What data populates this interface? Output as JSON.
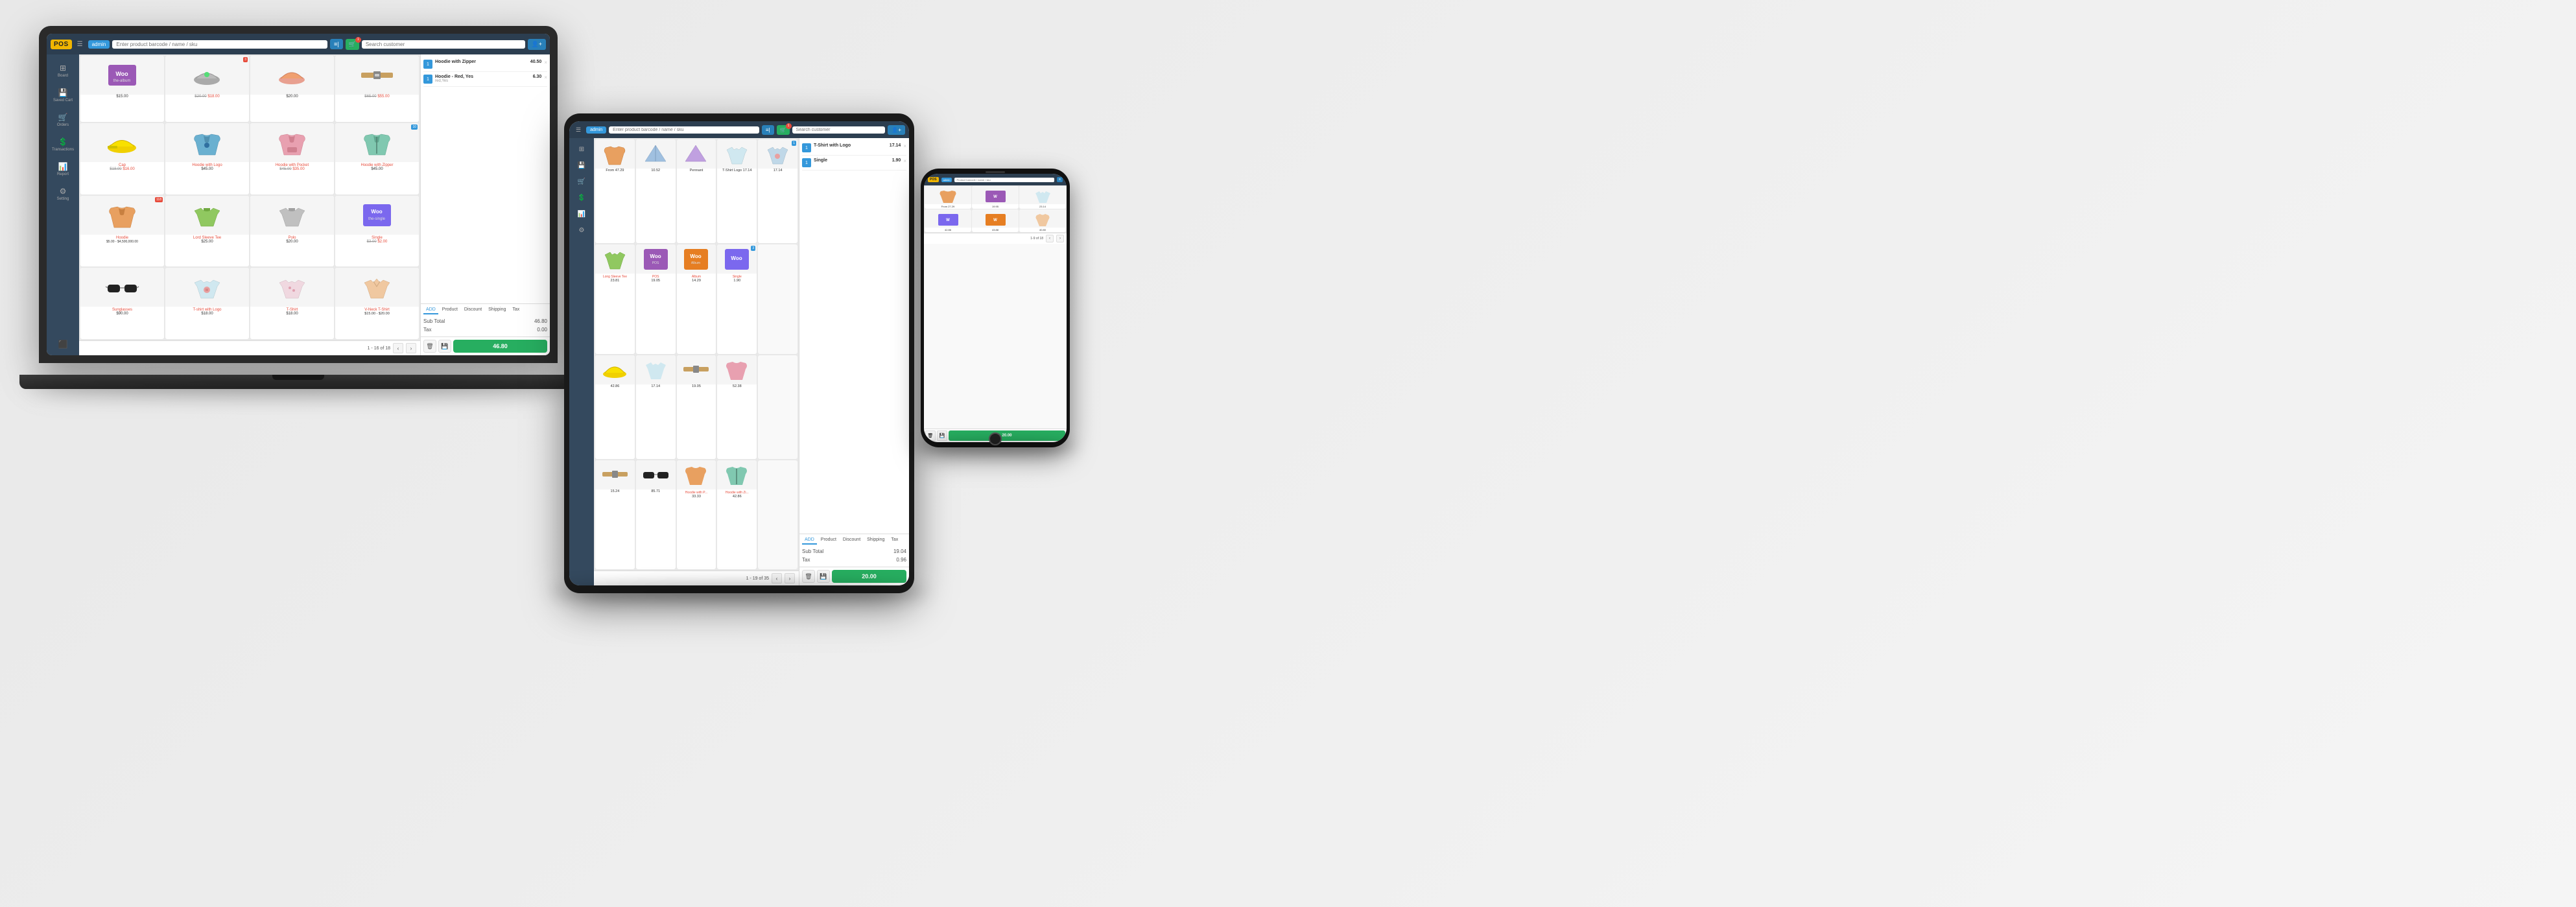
{
  "laptop": {
    "header": {
      "logo": "POS",
      "menu_icon": "☰",
      "admin_label": "admin",
      "search_product_placeholder": "Enter product barcode / name / sku",
      "filter_icon": "⚡",
      "cart_count": "1",
      "search_customer_placeholder": "Search customer",
      "add_customer_icon": "+"
    },
    "sidebar": {
      "items": [
        {
          "label": "Board",
          "icon": "⊞"
        },
        {
          "label": "Saved Cart",
          "icon": "💾"
        },
        {
          "label": "Orders",
          "icon": "🛒"
        },
        {
          "label": "Transactions",
          "icon": "$"
        },
        {
          "label": "Report",
          "icon": "©"
        },
        {
          "label": "Setting",
          "icon": "⚙"
        }
      ],
      "bottom_icon": "⬛"
    },
    "products": [
      {
        "name": "WooLogo",
        "price": "$15.00",
        "img_type": "woo",
        "badge": ""
      },
      {
        "name": "",
        "price": "$20.00 $18.00",
        "img_type": "hat_grey",
        "badge": "3"
      },
      {
        "name": "",
        "price": "$20.00",
        "img_type": "hat_orange",
        "badge": ""
      },
      {
        "name": "",
        "price": "$65.00 $55.00",
        "img_type": "belt",
        "badge": ""
      },
      {
        "name": "Cap",
        "price": "$18.00 $16.00",
        "img_type": "cap_yellow",
        "badge": ""
      },
      {
        "name": "Hoodie with Logo",
        "price": "$45.00",
        "img_type": "hoodie_blue",
        "badge": ""
      },
      {
        "name": "Hoodie with Pocket",
        "price": "$45.00 $35.00",
        "img_type": "hoodie_pink",
        "badge": ""
      },
      {
        "name": "Hoodie with Zipper",
        "price": "$45.00",
        "img_type": "hoodie_teal",
        "badge": "10"
      },
      {
        "name": "Hoodie",
        "price": "$5.00 - $4,500,000.00",
        "img_type": "hoodie_orange",
        "badge": "118"
      },
      {
        "name": "Lord Sleeve Tee",
        "price": "$25.00",
        "img_type": "tshirt_green",
        "badge": ""
      },
      {
        "name": "Polo",
        "price": "$20.00",
        "img_type": "polo_grey",
        "badge": ""
      },
      {
        "name": "Single",
        "price": "$3.00 $2.00",
        "img_type": "woo_single",
        "badge": ""
      },
      {
        "name": "Sunglasses",
        "price": "$90.00",
        "img_type": "glasses",
        "badge": ""
      },
      {
        "name": "T-shirt with Logo",
        "price": "$18.00",
        "img_type": "tshirt_logo",
        "badge": ""
      },
      {
        "name": "T-Shirt",
        "price": "$18.00",
        "img_type": "tshirt_plain",
        "badge": ""
      },
      {
        "name": "V-Neck T-Shirt",
        "price": "$15.00 - $20.00",
        "img_type": "vneck_peach",
        "badge": ""
      }
    ],
    "pagination": {
      "text": "1 - 16 of 18",
      "prev": "‹",
      "next": "›"
    },
    "order": {
      "items": [
        {
          "qty": "1",
          "name": "Hoodie with Zipper",
          "variant": "",
          "price": "40.50",
          "remove": "×"
        },
        {
          "qty": "1",
          "name": "Hoodie - Red, Yes",
          "variant": "red,Yes",
          "price": "6.30",
          "remove": "×"
        }
      ],
      "tabs": [
        "ADD",
        "Product",
        "Discount",
        "Shipping",
        "Tax"
      ],
      "active_tab": "ADD",
      "sub_total_label": "Sub Total",
      "sub_total_value": "46.80",
      "tax_label": "Tax",
      "tax_value": "0.00",
      "checkout_value": "46.80",
      "delete_icon": "🗑",
      "save_icon": "💾"
    }
  },
  "tablet": {
    "header": {
      "logo": "POS",
      "admin_label": "admin",
      "search_product_placeholder": "Enter product barcode / name / sku",
      "search_customer_placeholder": "Search customer"
    },
    "order": {
      "items": [
        {
          "qty": "1",
          "name": "T-Shirt with Logo",
          "price": "17.14"
        },
        {
          "qty": "1",
          "name": "Single",
          "price": "1.90"
        }
      ],
      "sub_total_label": "Sub Total",
      "sub_total_value": "19.04",
      "tax_label": "Tax",
      "tax_value": "0.96",
      "checkout_value": "20.00"
    },
    "products_row1": [
      {
        "price": "From 47.29",
        "img_type": "hoodie_dark"
      },
      {
        "price": "10.52",
        "img_type": "pennant"
      },
      {
        "price": "Pennant",
        "img_type": "pennant2"
      },
      {
        "price": "17.14",
        "img_type": "tshirt_logo2"
      },
      {
        "price": "17.14",
        "img_type": "tshirt_logo3"
      }
    ],
    "products_row2": [
      {
        "name": "Long Sleeve Tee",
        "price": "23.81",
        "img_type": "tshirt_ls"
      },
      {
        "name": "POS",
        "price": "19.05",
        "img_type": "woo2"
      },
      {
        "name": "Album",
        "price": "14.29",
        "img_type": "woo3"
      },
      {
        "name": "Single",
        "price": "1.90",
        "img_type": "woo4"
      }
    ],
    "products_row3": [
      {
        "price": "42.86"
      },
      {
        "price": "17.14"
      },
      {
        "price": "19.05"
      },
      {
        "price": "52.38"
      }
    ],
    "products_row4": [
      {
        "price": "15.24"
      },
      {
        "price": "85.71"
      },
      {
        "name": "Hoodie with P...",
        "price": "33.33"
      },
      {
        "name": "Hoodie with Zi...",
        "price": "42.86"
      }
    ],
    "pagination": "1 - 19 of 35"
  },
  "phone": {
    "header": {
      "logo": "POS",
      "admin_label": "admin"
    },
    "products": [
      {
        "price": "From 27.29"
      },
      {
        "price": "19.95"
      },
      {
        "price": "23.14"
      },
      {
        "price": "42.86"
      },
      {
        "price": "43.88"
      },
      {
        "price": "40.80"
      }
    ],
    "order": {
      "checkout_value": "20.00"
    }
  },
  "colors": {
    "accent_blue": "#3498db",
    "accent_green": "#27ae60",
    "accent_red": "#e74c3c",
    "header_bg": "#2c3e50",
    "sidebar_bg": "#34495e",
    "logo_yellow": "#f0b500"
  }
}
